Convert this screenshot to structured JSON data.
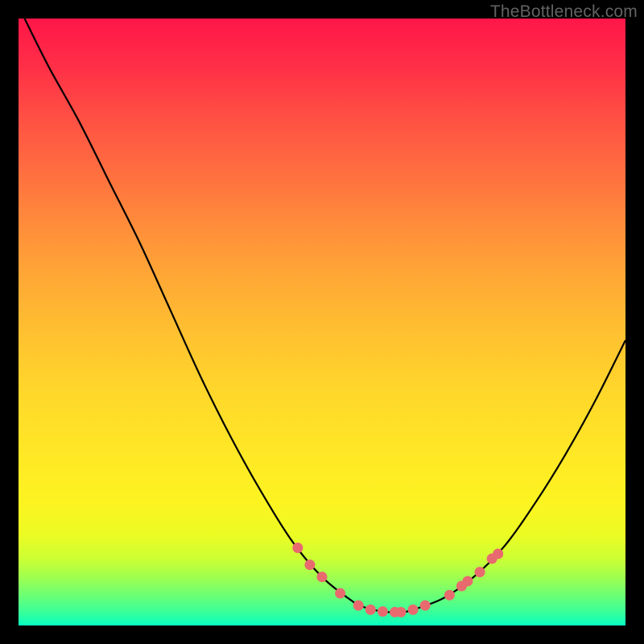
{
  "watermark": "TheBottleneck.com",
  "chart_data": {
    "type": "line",
    "title": "",
    "xlabel": "",
    "ylabel": "",
    "xlim": [
      0,
      100
    ],
    "ylim": [
      0,
      100
    ],
    "series": [
      {
        "name": "curve",
        "x": [
          1,
          5,
          10,
          15,
          20,
          25,
          30,
          35,
          40,
          45,
          50,
          55,
          57,
          60,
          63,
          65,
          70,
          75,
          80,
          85,
          90,
          95,
          100
        ],
        "y": [
          100,
          92,
          83,
          73,
          63,
          52,
          41,
          31,
          22,
          14,
          8,
          4,
          3,
          2.3,
          2.2,
          2.6,
          4.5,
          8,
          13,
          20,
          28,
          37,
          47
        ]
      }
    ],
    "markers": [
      {
        "x": 46,
        "y": 12.8
      },
      {
        "x": 48,
        "y": 10.0
      },
      {
        "x": 50,
        "y": 8.0
      },
      {
        "x": 53,
        "y": 5.3
      },
      {
        "x": 56,
        "y": 3.3
      },
      {
        "x": 58,
        "y": 2.6
      },
      {
        "x": 60,
        "y": 2.3
      },
      {
        "x": 62,
        "y": 2.2
      },
      {
        "x": 63,
        "y": 2.2
      },
      {
        "x": 65,
        "y": 2.6
      },
      {
        "x": 67,
        "y": 3.3
      },
      {
        "x": 71,
        "y": 5.0
      },
      {
        "x": 73,
        "y": 6.5
      },
      {
        "x": 74,
        "y": 7.3
      },
      {
        "x": 76,
        "y": 8.8
      },
      {
        "x": 78,
        "y": 11.0
      },
      {
        "x": 79,
        "y": 11.8
      }
    ],
    "marker_color": "#e86a6f",
    "curve_color": "#000000"
  }
}
